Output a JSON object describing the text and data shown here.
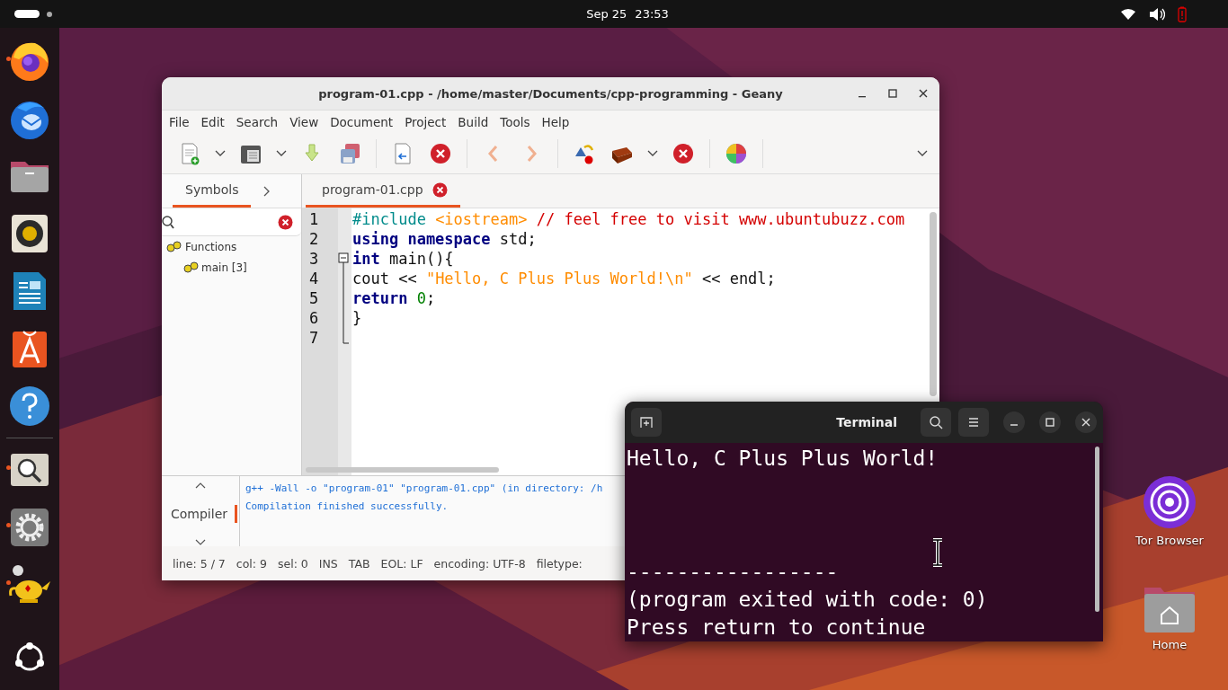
{
  "top_bar": {
    "date": "Sep 25",
    "time": "23:53"
  },
  "dock": [
    {
      "kind": "firefox",
      "running": true
    },
    {
      "kind": "mail",
      "running": false
    },
    {
      "kind": "files",
      "running": false
    },
    {
      "kind": "music",
      "running": false
    },
    {
      "kind": "writer",
      "running": false
    },
    {
      "kind": "store",
      "running": false
    },
    {
      "kind": "help",
      "running": false
    },
    {
      "kind": "viewer",
      "running": true
    },
    {
      "kind": "settings",
      "running": true
    },
    {
      "kind": "lamp",
      "running": true
    }
  ],
  "desktop_icons": [
    {
      "kind": "tor",
      "label": "Tor Browser"
    },
    {
      "kind": "home",
      "label": "Home"
    }
  ],
  "geany": {
    "title": "program-01.cpp - /home/master/Documents/cpp-programming - Geany",
    "menu": [
      "File",
      "Edit",
      "Search",
      "View",
      "Document",
      "Project",
      "Build",
      "Tools",
      "Help"
    ],
    "toolbar": [
      {
        "kind": "new"
      },
      {
        "kind": "dropdown"
      },
      {
        "kind": "open"
      },
      {
        "kind": "dropdown"
      },
      {
        "kind": "save"
      },
      {
        "kind": "save-all"
      },
      {
        "kind": "separator"
      },
      {
        "kind": "revert"
      },
      {
        "kind": "close"
      },
      {
        "kind": "separator"
      },
      {
        "kind": "back"
      },
      {
        "kind": "forward"
      },
      {
        "kind": "separator"
      },
      {
        "kind": "compile"
      },
      {
        "kind": "build"
      },
      {
        "kind": "dropdown"
      },
      {
        "kind": "close"
      },
      {
        "kind": "separator"
      },
      {
        "kind": "color"
      },
      {
        "kind": "separator"
      }
    ],
    "sidebar": {
      "tabs": [
        {
          "label": "Symbols",
          "selected": true
        }
      ],
      "tree": [
        {
          "label": "Functions",
          "children": [
            {
              "label": "main [3]"
            }
          ]
        }
      ]
    },
    "editor": {
      "tabs": [
        {
          "label": "program-01.cpp",
          "selected": true
        }
      ],
      "lines": [
        {
          "number": "1",
          "fold_start": false,
          "tokens": [
            {
              "kind": "preproc",
              "text": "#include "
            },
            {
              "kind": "string",
              "text": "<iostream>"
            },
            {
              "kind": "comment",
              "text": " // feel free to visit www.ubuntubuzz.com"
            }
          ]
        },
        {
          "number": "2",
          "fold_start": false,
          "tokens": [
            {
              "kind": "keyword",
              "text": "using namespace"
            },
            {
              "kind": "plain",
              "text": " std;"
            }
          ]
        },
        {
          "number": "3",
          "fold_start": true,
          "tokens": [
            {
              "kind": "keyword",
              "text": "int"
            },
            {
              "kind": "plain",
              "text": " main(){"
            }
          ]
        },
        {
          "number": "4",
          "fold_start": false,
          "tokens": [
            {
              "kind": "plain",
              "text": "cout << "
            },
            {
              "kind": "string",
              "text": "\"Hello, C Plus Plus World!\\n\""
            },
            {
              "kind": "plain",
              "text": " << endl;"
            }
          ]
        },
        {
          "number": "5",
          "fold_start": false,
          "tokens": [
            {
              "kind": "keyword",
              "text": "return "
            },
            {
              "kind": "number",
              "text": "0"
            },
            {
              "kind": "plain",
              "text": ";"
            }
          ]
        },
        {
          "number": "6",
          "fold_start": false,
          "tokens": [
            {
              "kind": "plain",
              "text": "}"
            }
          ]
        },
        {
          "number": "7",
          "fold_start": false
        }
      ]
    },
    "messages": {
      "tabs": [
        {
          "label": "Compiler",
          "selected": true
        }
      ],
      "lines": [
        "g++ -Wall -o \"program-01\" \"program-01.cpp\" (in directory: /h",
        "Compilation finished successfully."
      ]
    },
    "status_bar": [
      "line: 5 / 7",
      "col: 9",
      "sel: 0",
      "INS",
      "TAB",
      "EOL: LF",
      "encoding: UTF-8",
      "filetype:"
    ]
  },
  "terminal": {
    "title": "Terminal",
    "output": [
      "Hello, C Plus Plus World!"
    ],
    "footer": [
      "-----------------",
      "(program exited with code: 0)",
      "Press return to continue"
    ]
  }
}
